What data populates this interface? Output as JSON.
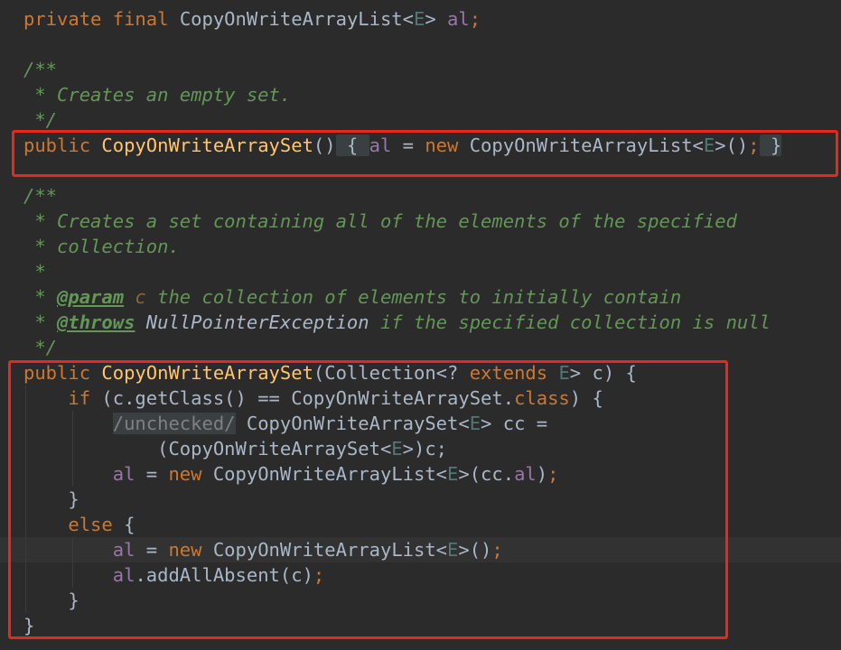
{
  "code": {
    "l1": {
      "kw1": "private",
      "kw2": "final",
      "type": "CopyOnWriteArrayList",
      "lt": "<",
      "gen": "E",
      "gt": ">",
      "field": "al",
      "semi": ";"
    },
    "l3": {
      "text": "/**"
    },
    "l4": {
      "text": " * Creates an empty set."
    },
    "l5": {
      "text": " */"
    },
    "l6": {
      "kw": "public",
      "name": "CopyOnWriteArraySet",
      "parens": "()",
      "open": " { ",
      "field": "al",
      "eq": " = ",
      "new": "new",
      "type": " CopyOnWriteArrayList<",
      "gen": "E",
      "close_gen": ">()",
      "semi": ";",
      "close": " }"
    },
    "l8": {
      "text": "/**"
    },
    "l9": {
      "text": " * Creates a set containing all of the elements of the specified"
    },
    "l10": {
      "text": " * collection."
    },
    "l11": {
      "text": " *"
    },
    "l12": {
      "prefix": " * ",
      "tag": "@param",
      "param": " c",
      "rest": " the collection of elements to initially contain"
    },
    "l13": {
      "prefix": " * ",
      "tag": "@throws",
      "ref": " NullPointerException",
      "rest": " if the specified collection is null"
    },
    "l14": {
      "text": " */"
    },
    "l15": {
      "kw": "public",
      "name": "CopyOnWriteArraySet",
      "args1": "(Collection<? ",
      "ext": "extends",
      "sp": " ",
      "gen": "E",
      "args2": "> c) {"
    },
    "l16": {
      "kw_if": "if",
      "cond1": " (c.getClass() == CopyOnWriteArraySet.",
      "kw_class": "class",
      "cond2": ") {"
    },
    "l17": {
      "folded": "/unchecked/",
      "rest": " CopyOnWriteArraySet<",
      "gen": "E",
      "rest2": "> cc ="
    },
    "l18": {
      "text": "(CopyOnWriteArraySet<",
      "gen": "E",
      "rest": ">)c;"
    },
    "l19": {
      "field": "al",
      "eq": " = ",
      "new": "new",
      "type": " CopyOnWriteArrayList<",
      "gen": "E",
      "mid": ">(cc.",
      "field2": "al",
      "close": ")",
      "semi": ";"
    },
    "l20": {
      "text": "}"
    },
    "l21": {
      "kw_else": "else",
      "brace": " {"
    },
    "l22": {
      "field": "al",
      "eq": " = ",
      "new": "new",
      "type": " CopyOnWriteArrayList<",
      "gen": "E",
      "close": ">()",
      "semi": ";"
    },
    "l23": {
      "field": "al",
      "call": ".addAllAbsent(c)",
      "semi": ";"
    },
    "l24": {
      "text": "}"
    },
    "l25": {
      "text": "}"
    }
  }
}
